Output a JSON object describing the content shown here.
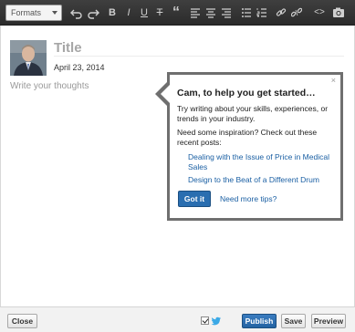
{
  "toolbar": {
    "formats_label": "Formats",
    "buttons": [
      "undo-icon",
      "redo-icon",
      "bold-icon",
      "italic-icon",
      "underline-icon",
      "strikethrough-icon",
      "blockquote-icon",
      "align-left-icon",
      "align-center-icon",
      "align-right-icon",
      "bulleted-list-icon",
      "numbered-list-icon",
      "link-icon",
      "unlink-icon",
      "code-icon",
      "camera-icon"
    ],
    "bold": "B",
    "italic": "I",
    "underline": "U",
    "strike": "T",
    "quote": "“",
    "code": "<>"
  },
  "post": {
    "title_placeholder": "Title",
    "date": "April 23, 2014",
    "body_placeholder": "Write your thoughts"
  },
  "popover": {
    "close": "×",
    "heading": "Cam, to help you get started…",
    "intro": "Try writing about your skills, experiences, or trends in your industry.",
    "inspiration": "Need some inspiration? Check out these recent posts:",
    "links": [
      "Dealing with the Issue of Price in Medical Sales",
      "Design to the Beat of a Different Drum"
    ],
    "got_it": "Got it",
    "more_tips": "Need more tips?"
  },
  "footer": {
    "close": "Close",
    "publish": "Publish",
    "save": "Save",
    "preview": "Preview",
    "share_checked": true
  },
  "colors": {
    "toolbar_bg": "#333333",
    "link": "#1a5fa3",
    "primary_button": "#2a6eb0"
  }
}
